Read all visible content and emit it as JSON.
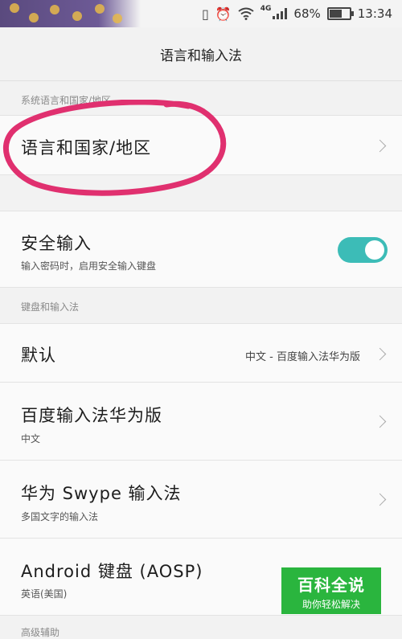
{
  "status_bar": {
    "network": "4G",
    "battery": "68%",
    "battery_level": 0.68,
    "time": "13:34"
  },
  "header": {
    "title": "语言和输入法"
  },
  "sections": {
    "system_language": "系统语言和国家/地区",
    "keyboard": "键盘和输入法",
    "advanced": "高级辅助"
  },
  "language_row": {
    "title": "语言和国家/地区"
  },
  "secure_input": {
    "title": "安全输入",
    "subtitle": "输入密码时，启用安全输入键盘",
    "enabled": true
  },
  "default_row": {
    "title": "默认",
    "value": "中文 - 百度输入法华为版"
  },
  "input_methods": [
    {
      "title": "百度输入法华为版",
      "subtitle": "中文"
    },
    {
      "title": "华为 Swype 输入法",
      "subtitle": "多国文字的输入法"
    },
    {
      "title": "Android 键盘 (AOSP)",
      "subtitle": "英语(美国)"
    }
  ],
  "watermark": {
    "main": "百科全说",
    "sub": "助你轻松解决"
  },
  "colors": {
    "accent": "#3cbcb7",
    "annotation": "#e0306f",
    "watermark": "#2ab53e"
  }
}
